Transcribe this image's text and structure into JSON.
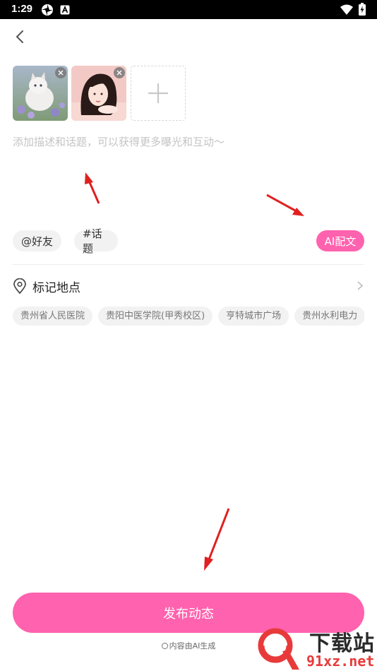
{
  "status_bar": {
    "time": "1:29",
    "icons": [
      "pinwheel-icon",
      "a-badge-icon",
      "wifi-icon",
      "battery-charging-icon"
    ]
  },
  "header": {
    "back_icon": "back-arrow-icon"
  },
  "photos": {
    "items": [
      {
        "name": "photo-white-cat",
        "remove_icon": "close-icon"
      },
      {
        "name": "photo-girl-portrait",
        "remove_icon": "close-icon"
      }
    ],
    "add_icon": "plus-icon"
  },
  "description": {
    "placeholder": "添加描述和话题，可以获得更多曝光和互动～",
    "value": ""
  },
  "tools": {
    "mention_label": "@好友",
    "topic_label": "#话题",
    "ai_label": "AI配文"
  },
  "location": {
    "label": "标记地点",
    "icon": "location-pin-icon",
    "chevron": "chevron-right-icon",
    "suggestions": [
      "贵州省人民医院",
      "贵阳中医学院(甲秀校区)",
      "亨特城市广场",
      "贵州水利电力"
    ]
  },
  "publish": {
    "label": "发布动态",
    "note": "内容由AI生成"
  },
  "watermark": {
    "text": "下载站",
    "url": "91xz.net"
  },
  "colors": {
    "accent": "#ff62ae",
    "chip_bg": "#f2f2f2",
    "placeholder": "#c4c4c4",
    "annotation_arrow": "#e02020"
  }
}
